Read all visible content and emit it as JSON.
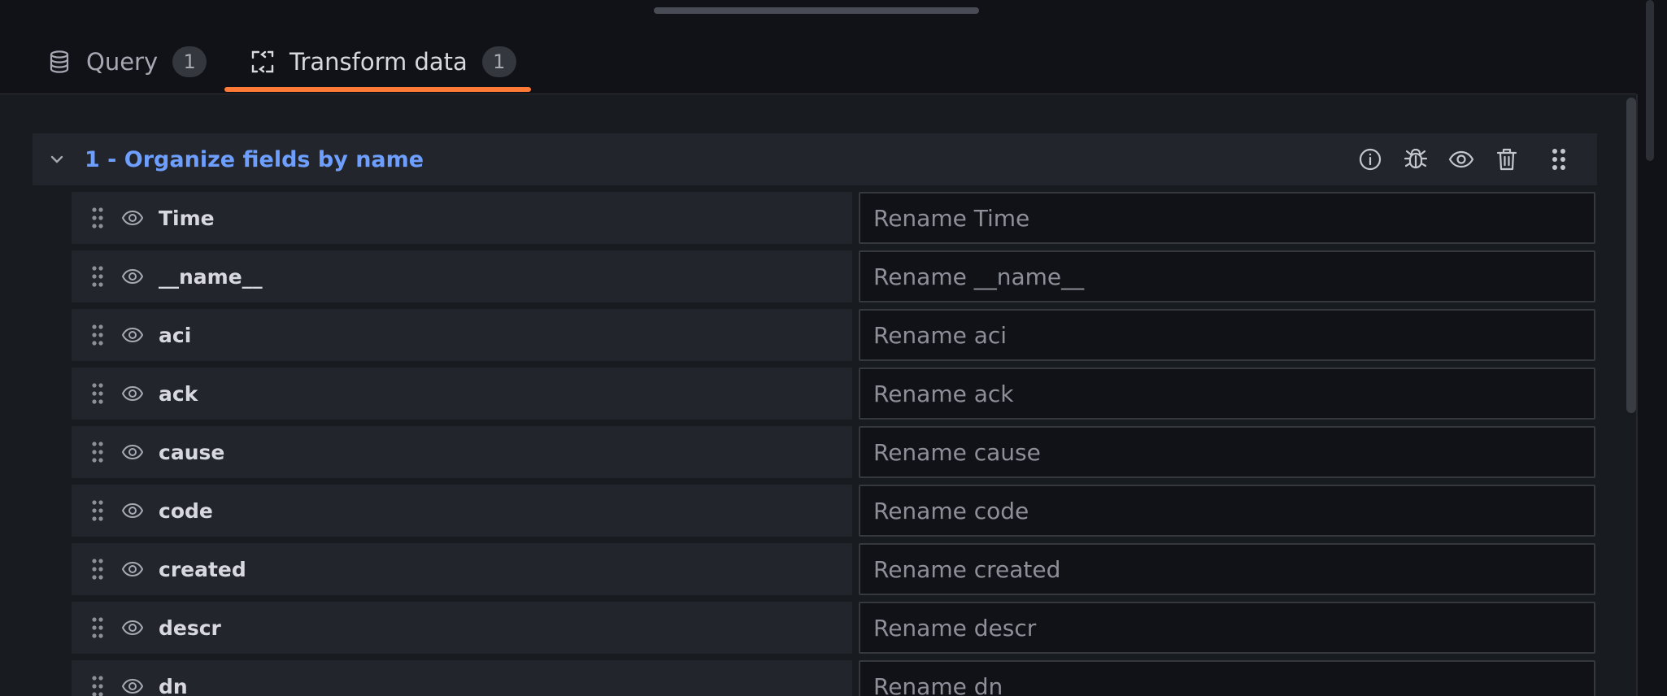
{
  "tabs": [
    {
      "label": "Query",
      "count": "1",
      "icon": "database-icon",
      "active": false
    },
    {
      "label": "Transform data",
      "count": "1",
      "icon": "transform-icon",
      "active": true
    }
  ],
  "colors": {
    "accent": "#ff7a37",
    "title": "#6e9fff",
    "background": "#111217",
    "panel": "#181b1f",
    "row": "#22252b"
  },
  "transformation": {
    "title": "1 - Organize fields by name",
    "actions": [
      "info-icon",
      "debug-icon",
      "eye-icon",
      "trash-icon",
      "drag-handle-icon"
    ]
  },
  "fields": [
    {
      "name": "Time",
      "placeholder": "Rename Time"
    },
    {
      "name": "__name__",
      "placeholder": "Rename __name__"
    },
    {
      "name": "aci",
      "placeholder": "Rename aci"
    },
    {
      "name": "ack",
      "placeholder": "Rename ack"
    },
    {
      "name": "cause",
      "placeholder": "Rename cause"
    },
    {
      "name": "code",
      "placeholder": "Rename code"
    },
    {
      "name": "created",
      "placeholder": "Rename created"
    },
    {
      "name": "descr",
      "placeholder": "Rename descr"
    },
    {
      "name": "dn",
      "placeholder": "Rename dn"
    }
  ]
}
